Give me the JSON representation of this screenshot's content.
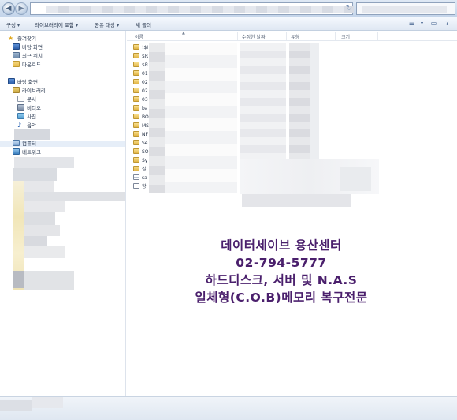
{
  "toolbar": {
    "organize": "구성",
    "include_library": "라이브러리에 포함",
    "share_with": "공유 대상",
    "new_folder": "새 폴더",
    "dropdown_arrow": "▾",
    "view_icon": "view-options-icon",
    "preview_icon": "preview-pane-icon",
    "help_icon": "help-icon"
  },
  "address": {
    "refresh_glyph": "↻"
  },
  "sidebar": {
    "favorites": "즐겨찾기",
    "favorites_items": [
      "바탕 화면",
      "최근 위치",
      "다운로드"
    ],
    "desktop": "바탕 화면",
    "libraries": "라이브러리",
    "library_items": [
      "문서",
      "비디오",
      "사진",
      "음악"
    ],
    "computer": "컴퓨터",
    "network": "네트워크"
  },
  "columns": {
    "name": "이름",
    "modified": "수정한 날짜",
    "type": "유형",
    "size": "크기"
  },
  "files": [
    {
      "label": "!$I",
      "kind": "folder"
    },
    {
      "label": "$R",
      "kind": "folder"
    },
    {
      "label": "$R",
      "kind": "folder"
    },
    {
      "label": "01",
      "kind": "folder"
    },
    {
      "label": "02",
      "kind": "folder"
    },
    {
      "label": "02",
      "kind": "folder"
    },
    {
      "label": "03",
      "kind": "folder"
    },
    {
      "label": "ba",
      "kind": "folder"
    },
    {
      "label": "BO",
      "kind": "folder"
    },
    {
      "label": "MS",
      "kind": "folder"
    },
    {
      "label": "NF",
      "kind": "folder"
    },
    {
      "label": "Se",
      "kind": "folder"
    },
    {
      "label": "SO",
      "kind": "folder"
    },
    {
      "label": "Sy",
      "kind": "folder"
    },
    {
      "label": "설",
      "kind": "folder"
    },
    {
      "label": "sa",
      "kind": "cfg"
    },
    {
      "label": "항",
      "kind": "file"
    }
  ],
  "overlay": {
    "line1": "데이터세이브 용산센터",
    "line2": "02-794-5777",
    "line3": "하드디스크, 서버 및 N.A.S",
    "line4": "일체형(C.O.B)메모리 복구전문"
  },
  "colors": {
    "overlay_text": "#4a1f6c",
    "toolbar_bg": "#dfe8f3"
  }
}
